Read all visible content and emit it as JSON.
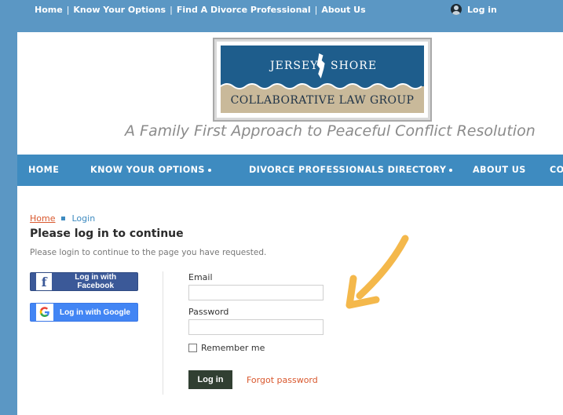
{
  "top_nav": {
    "items": [
      "Home",
      "Know Your Options",
      "Find A Divorce Professional",
      "About Us"
    ],
    "separator": "|",
    "login": "Log in"
  },
  "logo": {
    "top_left": "JERSEY",
    "top_right": "SHORE",
    "bottom": "COLLABORATIVE LAW GROUP"
  },
  "tagline": "A Family First Approach to Peaceful Conflict Resolution",
  "main_nav": {
    "items": [
      "HOME",
      "KNOW YOUR OPTIONS",
      "DIVORCE PROFESSIONALS DIRECTORY",
      "ABOUT US",
      "CO"
    ]
  },
  "breadcrumb": {
    "home": "Home",
    "current": "Login"
  },
  "login_panel": {
    "heading": "Please log in to continue",
    "subtext": "Please login to continue to the page you have requested.",
    "facebook": "Log in with Facebook",
    "google": "Log in with Google",
    "email_label": "Email",
    "email_value": "",
    "password_label": "Password",
    "password_value": "",
    "remember": "Remember me",
    "login_button": "Log in",
    "forgot": "Forgot password"
  },
  "colors": {
    "page_frame": "#5b97c4",
    "nav_blue": "#3e8bc0",
    "orange": "#d9582e",
    "arrow": "#f4b84b",
    "facebook": "#3b5998",
    "google": "#4285f4",
    "button": "#313f32"
  },
  "icons": [
    "user-icon",
    "facebook-icon",
    "google-icon",
    "arrow-icon"
  ]
}
